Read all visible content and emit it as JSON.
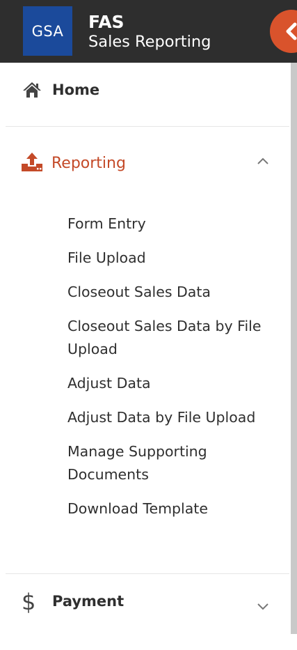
{
  "header": {
    "logo_text": "GSA",
    "title": "FAS",
    "subtitle": "Sales Reporting",
    "collapse_icon": "chevron-left-icon",
    "colors": {
      "bar": "#2e2e2e",
      "logo": "#1b4a9b",
      "accent": "#d9532c"
    }
  },
  "nav": {
    "home": {
      "label": "Home",
      "icon": "home-icon"
    },
    "reporting": {
      "label": "Reporting",
      "icon": "upload-icon",
      "expanded": true,
      "toggle_icon": "chevron-up-icon",
      "color": "#c44a28",
      "items": [
        "Form Entry",
        "File Upload",
        "Closeout Sales Data",
        "Closeout Sales Data by File Upload",
        "Adjust Data",
        "Adjust Data by File Upload",
        "Manage Supporting Documents",
        "Download Template"
      ]
    },
    "payment": {
      "label": "Payment",
      "icon": "dollar-icon",
      "expanded": false,
      "toggle_icon": "chevron-down-icon"
    }
  }
}
